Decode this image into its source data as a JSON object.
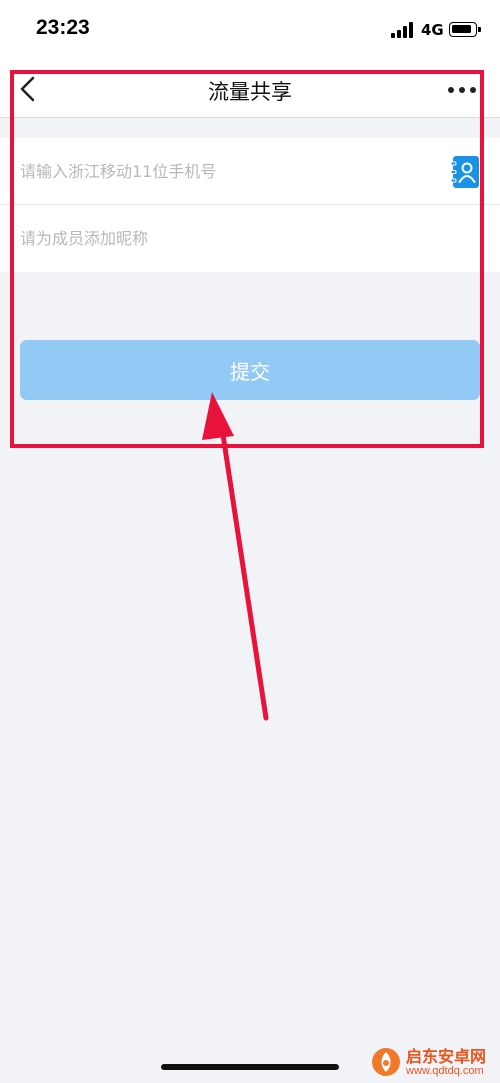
{
  "status_bar": {
    "time": "23:23",
    "network": "4G",
    "icons": [
      "signal-bars-icon",
      "battery-icon"
    ]
  },
  "nav": {
    "title": "流量共享",
    "icons": [
      "back-chevron-icon",
      "more-dots-icon"
    ]
  },
  "form": {
    "phone_placeholder": "请输入浙江移动11位手机号",
    "nickname_placeholder": "请为成员添加昵称",
    "phone_value": "",
    "nickname_value": "",
    "contact_icon": "contact-book-icon"
  },
  "submit": {
    "label": "提交"
  },
  "watermark": {
    "name": "启东安卓网",
    "url": "www.qdtdq.com"
  },
  "colors": {
    "page_background": "#f2f3f7",
    "accent": "#1a93e6",
    "button_disabled": "#93c9f5",
    "annotation": "#e8123c"
  }
}
